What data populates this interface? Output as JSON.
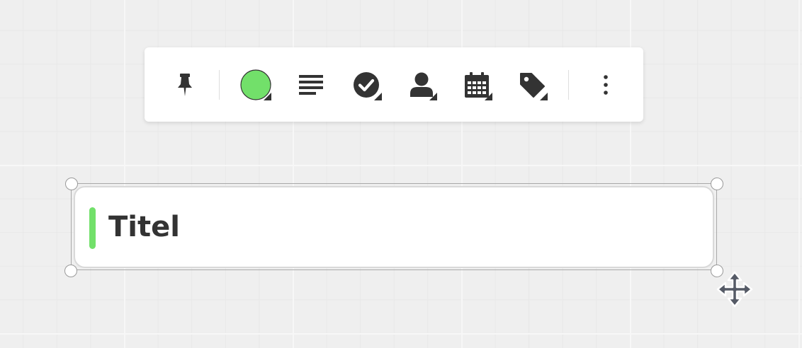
{
  "toolbar": {
    "items": [
      {
        "name": "pin",
        "icon": "pin-icon"
      },
      {
        "name": "color",
        "icon": "color-circle-icon",
        "color": "#72e06a"
      },
      {
        "name": "text-align",
        "icon": "text-lines-icon"
      },
      {
        "name": "status",
        "icon": "check-circle-icon"
      },
      {
        "name": "assignee",
        "icon": "user-icon"
      },
      {
        "name": "due-date",
        "icon": "calendar-icon"
      },
      {
        "name": "tags",
        "icon": "tag-icon"
      },
      {
        "name": "more",
        "icon": "more-vertical-icon"
      }
    ]
  },
  "card": {
    "title": "Titel",
    "accent_color": "#72e06a"
  },
  "colors": {
    "icon": "#333333",
    "accent": "#72e06a"
  }
}
